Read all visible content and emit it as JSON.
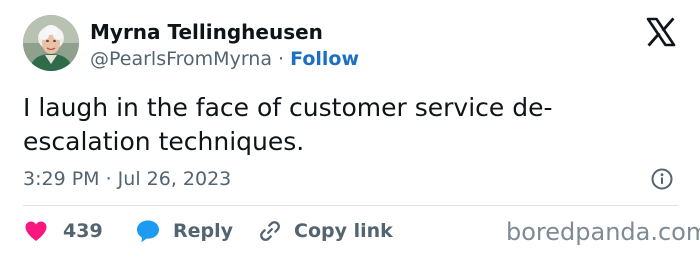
{
  "author": {
    "name": "Myrna Tellingheusen",
    "handle": "@PearlsFromMyrna",
    "separator": "·",
    "follow_label": "Follow"
  },
  "tweet": {
    "text_line1": "I laugh in the face of customer service de-",
    "text_line2": "escalation techniques.",
    "timestamp": "3:29 PM · Jul 26, 2023"
  },
  "actions": {
    "like_count": "439",
    "reply_label": "Reply",
    "copy_link_label": "Copy link"
  },
  "watermark": "boredpanda.com",
  "icons": {
    "brand": "x-logo-icon",
    "info": "info-icon",
    "like": "heart-icon",
    "reply": "speech-bubble-icon",
    "copy": "link-icon"
  },
  "colors": {
    "like": "#f91880",
    "reply": "#1d9bf0",
    "follow": "#1d6fc4",
    "muted_text": "#536471",
    "main_text": "#0f1419"
  }
}
